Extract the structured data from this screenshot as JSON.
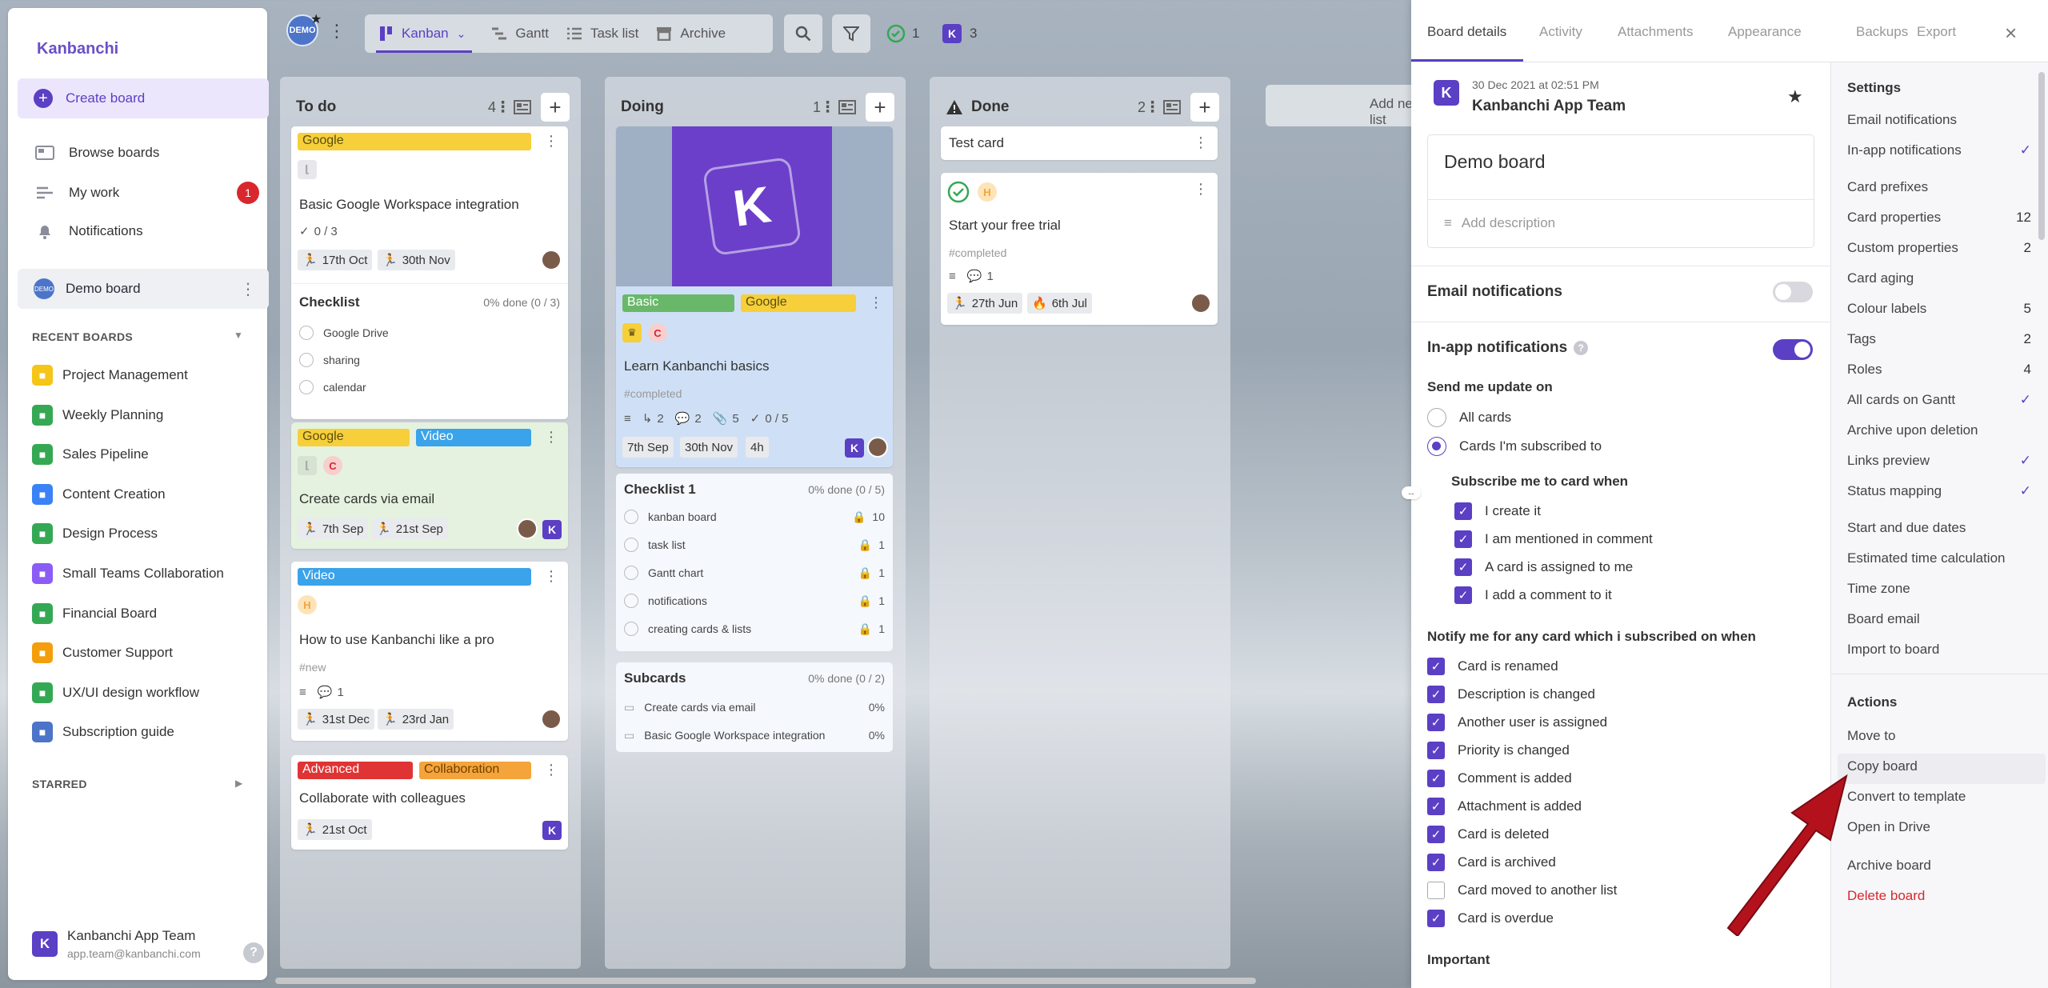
{
  "sidebar": {
    "logo": "Kanbanchi",
    "create_board": "Create board",
    "browse": "Browse boards",
    "my_work": "My work",
    "my_work_badge": "1",
    "notifications": "Notifications",
    "current_board": "Demo board",
    "recent_label": "RECENT BOARDS",
    "recent": [
      {
        "name": "Project Management",
        "color": "#f5c518",
        "icon": "document-icon"
      },
      {
        "name": "Weekly Planning",
        "color": "#35a854",
        "icon": "table-icon"
      },
      {
        "name": "Sales Pipeline",
        "color": "#35a854",
        "icon": "dollar-icon"
      },
      {
        "name": "Content Creation",
        "color": "#3b82f6",
        "icon": "pen-icon"
      },
      {
        "name": "Design Process",
        "color": "#35a854",
        "icon": "palette-icon"
      },
      {
        "name": "Small Teams Collaboration",
        "color": "#8b5cf6",
        "icon": "people-icon"
      },
      {
        "name": "Financial Board",
        "color": "#35a854",
        "icon": "dollar-icon"
      },
      {
        "name": "Customer Support",
        "color": "#f59e0b",
        "icon": "people-icon"
      },
      {
        "name": "UX/UI design workflow",
        "color": "#35a854",
        "icon": "smile-icon"
      },
      {
        "name": "Subscription guide",
        "color": "#4c74c9",
        "icon": "guide-icon"
      }
    ],
    "starred_label": "STARRED",
    "user_name": "Kanbanchi App Team",
    "user_email": "app.team@kanbanchi.com",
    "avatar_letter": "K",
    "demo_avatar_text": "DEMO"
  },
  "topbar": {
    "views": [
      "Kanban",
      "Gantt",
      "Task list",
      "Archive"
    ],
    "done_count": "1",
    "user_count": "3",
    "user_letter": "K",
    "add_list": "Add new list"
  },
  "lists": [
    {
      "title": "To do",
      "count": "4"
    },
    {
      "title": "Doing",
      "count": "1"
    },
    {
      "title": "Done",
      "count": "2"
    }
  ],
  "todo": {
    "c1": {
      "tag": "Google",
      "title": "Basic Google Workspace integration",
      "progress": "0 / 3",
      "start": "17th Oct",
      "due": "30th Nov",
      "checklist": "Checklist",
      "checklist_pct": "0% done (0 / 3)",
      "items": [
        "Google Drive",
        "sharing",
        "calendar"
      ]
    },
    "c2": {
      "tag1": "Google",
      "tag2": "Video",
      "title": "Create cards via email",
      "start": "7th Sep",
      "due": "21st Sep",
      "c_letter": "C"
    },
    "c3": {
      "tag": "Video",
      "title": "How to use Kanbanchi like a pro",
      "hash": "#new",
      "comments": "1",
      "start": "31st Dec",
      "due": "23rd Jan",
      "h_letter": "H"
    },
    "c4": {
      "tag1": "Advanced",
      "tag2": "Collaboration",
      "title": "Collaborate with colleagues",
      "due": "21st Oct"
    }
  },
  "doing": {
    "cover_letter": "K",
    "tag1": "Basic",
    "tag2": "Google",
    "title": "Learn Kanbanchi basics",
    "hash": "#completed",
    "subcards": "2",
    "comments": "2",
    "attachments": "5",
    "progress": "0 / 5",
    "start": "7th Sep",
    "due": "30th Nov",
    "estimate": "4h",
    "c_letter": "C",
    "checklist": "Checklist 1",
    "checklist_pct": "0% done (0 / 5)",
    "items": [
      {
        "name": "kanban board",
        "v": "10"
      },
      {
        "name": "task list",
        "v": "1"
      },
      {
        "name": "Gantt chart",
        "v": "1"
      },
      {
        "name": "notifications",
        "v": "1"
      },
      {
        "name": "creating cards & lists",
        "v": "1"
      }
    ],
    "sub_title": "Subcards",
    "sub_pct": "0% done (0 / 2)",
    "subs": [
      {
        "name": "Create cards via email",
        "v": "0%"
      },
      {
        "name": "Basic Google Workspace integration",
        "v": "0%"
      }
    ]
  },
  "done": {
    "c1": {
      "title": "Test card"
    },
    "c2": {
      "title": "Start your free trial",
      "hash": "#completed",
      "comments": "1",
      "start": "27th Jun",
      "due": "6th Jul",
      "h_letter": "H"
    }
  },
  "panel": {
    "tabs": [
      "Board details",
      "Activity",
      "Attachments",
      "Appearance",
      "Backups",
      "Export"
    ],
    "date": "30 Dec 2021 at 02:51 PM",
    "team": "Kanbanchi App Team",
    "board_name": "Demo board",
    "add_desc": "Add description",
    "email_notifications": "Email notifications",
    "inapp_notifications": "In-app notifications",
    "help": "?",
    "send_update": "Send me update on",
    "all_cards": "All cards",
    "subscribed_cards": "Cards I'm subscribed to",
    "subscribe_when": "Subscribe me to card when",
    "subscribe_items": [
      "I create it",
      "I am mentioned in comment",
      "A card is assigned to me",
      "I add a comment to it"
    ],
    "notify_label": "Notify me for any card which i subscribed on when",
    "notify_items": [
      {
        "t": "Card is renamed",
        "on": true
      },
      {
        "t": "Description is changed",
        "on": true
      },
      {
        "t": "Another user is assigned",
        "on": true
      },
      {
        "t": "Priority is changed",
        "on": true
      },
      {
        "t": "Comment is added",
        "on": true
      },
      {
        "t": "Attachment is added",
        "on": true
      },
      {
        "t": "Card is deleted",
        "on": true
      },
      {
        "t": "Card is archived",
        "on": true
      },
      {
        "t": "Card moved to another list",
        "on": false
      },
      {
        "t": "Card is overdue",
        "on": true
      }
    ],
    "important": "Important"
  },
  "settings": {
    "title": "Settings",
    "items": [
      {
        "t": "Email notifications",
        "v": ""
      },
      {
        "t": "In-app notifications",
        "v": "✓"
      },
      {
        "t": "Card prefixes",
        "v": ""
      },
      {
        "t": "Card properties",
        "v": "12"
      },
      {
        "t": "Custom properties",
        "v": "2"
      },
      {
        "t": "Card aging",
        "v": ""
      },
      {
        "t": "Colour labels",
        "v": "5"
      },
      {
        "t": "Tags",
        "v": "2"
      },
      {
        "t": "Roles",
        "v": "4"
      },
      {
        "t": "All cards on Gantt",
        "v": "✓"
      },
      {
        "t": "Archive upon deletion",
        "v": ""
      },
      {
        "t": "Links preview",
        "v": "✓"
      },
      {
        "t": "Status mapping",
        "v": "✓"
      },
      {
        "t": "Start and due dates",
        "v": ""
      },
      {
        "t": "Estimated time calculation",
        "v": ""
      },
      {
        "t": "Time zone",
        "v": ""
      },
      {
        "t": "Board email",
        "v": ""
      },
      {
        "t": "Import to board",
        "v": ""
      }
    ],
    "actions_title": "Actions",
    "actions": [
      "Move to",
      "Copy board",
      "Convert to template",
      "Open in Drive",
      "Archive board",
      "Delete board"
    ]
  },
  "colors": {
    "accent": "#5b3fc4",
    "danger": "#d9272e",
    "arrow": "#b3121d"
  }
}
